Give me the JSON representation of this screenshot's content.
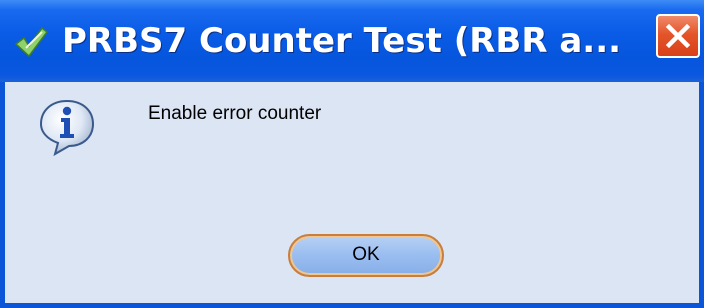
{
  "window": {
    "title": "PRBS7 Counter Test  (RBR a...",
    "title_icon": "checkmark-icon",
    "close_icon": "close-icon"
  },
  "dialog": {
    "icon": "information-icon",
    "message": "Enable error counter",
    "ok_label": "OK"
  },
  "colors": {
    "titlebar_blue": "#0a5ce6",
    "body_background": "#dbe5f4",
    "close_red": "#e4552a",
    "button_focus_orange": "#c97e3b"
  }
}
